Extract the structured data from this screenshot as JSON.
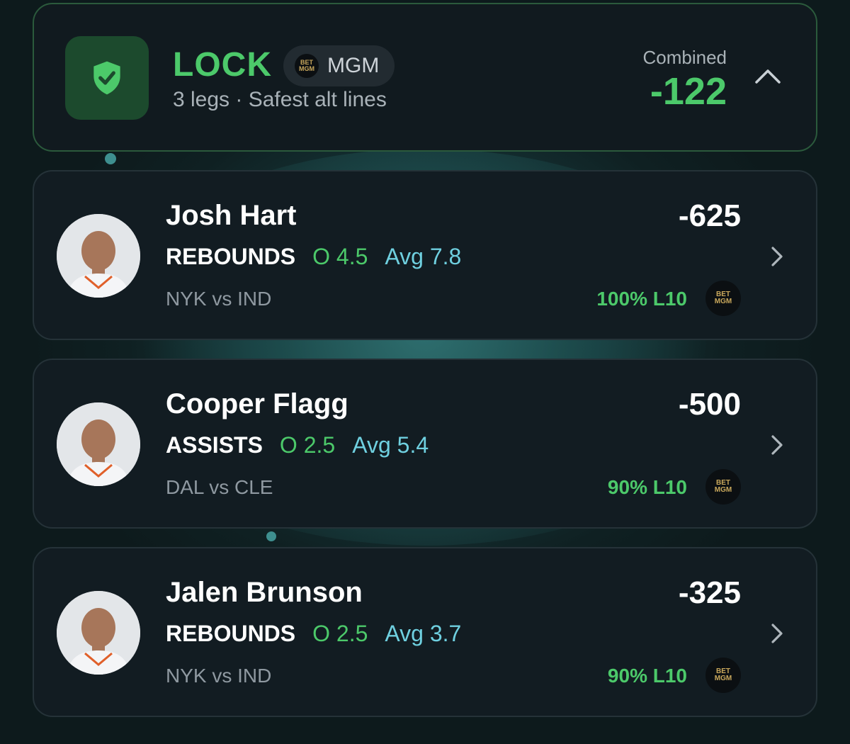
{
  "header": {
    "title": "LOCK",
    "book_badge": "MGM",
    "book_logo_text": [
      "BET",
      "MGM"
    ],
    "subtitle": "3 legs · Safest alt lines",
    "combined_label": "Combined",
    "combined_odds": "-122",
    "icon": "shield-check-icon",
    "expand_icon": "chevron-up-icon"
  },
  "legs": [
    {
      "player": "Josh Hart",
      "stat_type": "REBOUNDS",
      "line": "O 4.5",
      "avg": "Avg 7.8",
      "matchup": "NYK vs IND",
      "odds": "-625",
      "hit_rate": "100% L10",
      "jersey_color": "#ffffff"
    },
    {
      "player": "Cooper Flagg",
      "stat_type": "ASSISTS",
      "line": "O 2.5",
      "avg": "Avg 5.4",
      "matchup": "DAL vs CLE",
      "odds": "-500",
      "hit_rate": "90% L10",
      "jersey_color": "#ffffff"
    },
    {
      "player": "Jalen Brunson",
      "stat_type": "REBOUNDS",
      "line": "O 2.5",
      "avg": "Avg 3.7",
      "matchup": "NYK vs IND",
      "odds": "-325",
      "hit_rate": "90% L10",
      "jersey_color": "#ffffff"
    }
  ],
  "colors": {
    "accent_green": "#4cc96a",
    "avg_cyan": "#6fd0e0",
    "card_bg": "#121c22",
    "shield_bg": "#1c4a2d"
  }
}
